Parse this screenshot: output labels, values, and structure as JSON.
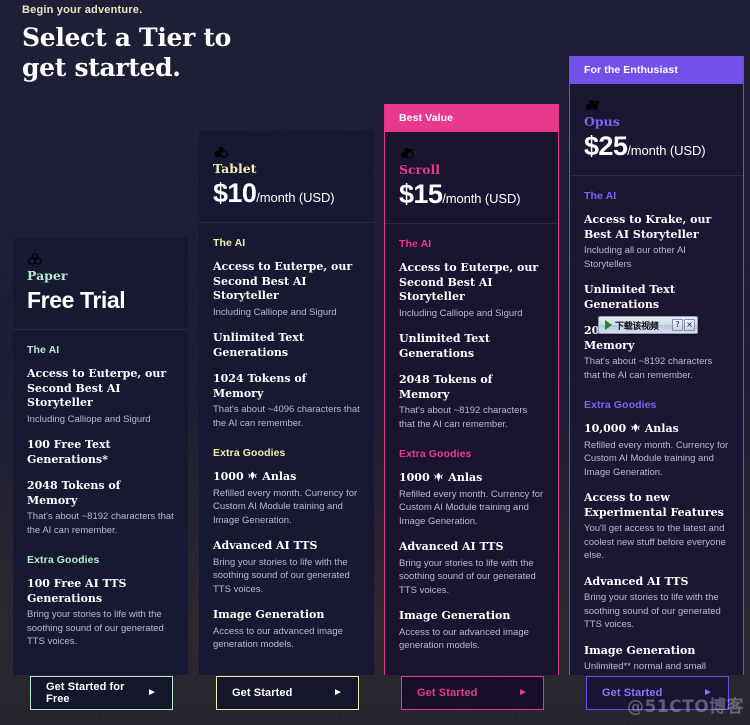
{
  "header": {
    "eyebrow": "Begin your adventure.",
    "headline_line1": "Select a Tier to",
    "headline_line2": "get started."
  },
  "colors": {
    "page_bg": "#1d1e35",
    "card_bg": "#171831",
    "paper_accent": "#b7e9cf",
    "tablet_accent": "#f0edb4",
    "scroll_accent": "#e8398f",
    "opus_accent": "#7f62f2",
    "body_text": "#b9bacb",
    "heading_text": "#ffffff"
  },
  "tiers": [
    {
      "key": "paper",
      "icon": "three-rings-icon",
      "badge": null,
      "name": "Paper",
      "price_amount": "Free Trial",
      "price_period": "",
      "is_free": true,
      "sections": [
        {
          "title": "The AI",
          "features": [
            {
              "title": "Access to Euterpe, our Second Best AI Storyteller",
              "desc": "Including Calliope and Sigurd"
            },
            {
              "title": "100 Free Text Generations*",
              "desc": ""
            },
            {
              "title": "2048 Tokens of Memory",
              "desc": "That's about ~8192 characters that the AI can remember."
            }
          ]
        },
        {
          "title": "Extra Goodies",
          "features": [
            {
              "title": "100 Free AI TTS Generations",
              "desc": "Bring your stories to life with the soothing sound of our generated TTS voices."
            }
          ]
        }
      ],
      "cta_label": "Get Started for Free"
    },
    {
      "key": "tablet",
      "icon": "two-rings-icon",
      "badge": null,
      "name": "Tablet",
      "price_amount": "$10",
      "price_period": "/month (USD)",
      "is_free": false,
      "sections": [
        {
          "title": "The AI",
          "features": [
            {
              "title": "Access to Euterpe, our Second Best AI Storyteller",
              "desc": "Including Calliope and Sigurd"
            },
            {
              "title": "Unlimited Text Generations",
              "desc": ""
            },
            {
              "title": "1024 Tokens of Memory",
              "desc": "That's about ~4096 characters that the AI can remember."
            }
          ]
        },
        {
          "title": "Extra Goodies",
          "features": [
            {
              "title": "1000 ⚘ Anlas",
              "desc": "Refilled every month. Currency for Custom AI Module training and Image Generation."
            },
            {
              "title": "Advanced AI TTS",
              "desc": "Bring your stories to life with the soothing sound of our generated TTS voices."
            },
            {
              "title": "Image Generation",
              "desc": "Access to our advanced image generation models."
            }
          ]
        }
      ],
      "cta_label": "Get Started"
    },
    {
      "key": "scroll",
      "icon": "cluster-rings-icon",
      "badge": "Best Value",
      "name": "Scroll",
      "price_amount": "$15",
      "price_period": "/month (USD)",
      "is_free": false,
      "sections": [
        {
          "title": "The AI",
          "features": [
            {
              "title": "Access to Euterpe, our Second Best AI Storyteller",
              "desc": "Including Calliope and Sigurd"
            },
            {
              "title": "Unlimited Text Generations",
              "desc": ""
            },
            {
              "title": "2048 Tokens of Memory",
              "desc": "That's about ~8192 characters that the AI can remember."
            }
          ]
        },
        {
          "title": "Extra Goodies",
          "features": [
            {
              "title": "1000 ⚘ Anlas",
              "desc": "Refilled every month. Currency for Custom AI Module training and Image Generation."
            },
            {
              "title": "Advanced AI TTS",
              "desc": "Bring your stories to life with the soothing sound of our generated TTS voices."
            },
            {
              "title": "Image Generation",
              "desc": "Access to our advanced image generation models."
            }
          ]
        }
      ],
      "cta_label": "Get Started"
    },
    {
      "key": "opus",
      "icon": "full-rings-icon",
      "badge": "For the Enthusiast",
      "name": "Opus",
      "price_amount": "$25",
      "price_period": "/month (USD)",
      "is_free": false,
      "sections": [
        {
          "title": "The AI",
          "features": [
            {
              "title": "Access to Krake, our Best AI Storyteller",
              "desc": "Including all our other AI Storytellers"
            },
            {
              "title": "Unlimited Text Generations",
              "desc": ""
            },
            {
              "title": "2048 Tokens of Memory",
              "desc": "That's about ~8192 characters that the AI can remember."
            }
          ]
        },
        {
          "title": "Extra Goodies",
          "features": [
            {
              "title": "10,000 ⚘ Anlas",
              "desc": "Refilled every month. Currency for Custom AI Module training and Image Generation."
            },
            {
              "title": "Access to new Experimental Features",
              "desc": "You'll get access to the latest and coolest new stuff before everyone else."
            },
            {
              "title": "Advanced AI TTS",
              "desc": "Bring your stories to life with the soothing sound of our generated TTS voices."
            },
            {
              "title": "Image Generation",
              "desc": "Unlimited** normal and small sized generations."
            }
          ]
        }
      ],
      "cta_label": "Get Started"
    }
  ],
  "download_widget": {
    "label": "下载该视频",
    "help_label": "?",
    "close_label": "×"
  },
  "watermark": "@51CTO博客"
}
